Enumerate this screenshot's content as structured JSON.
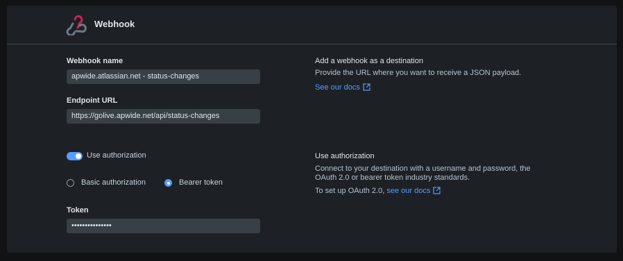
{
  "header": {
    "title": "Webhook"
  },
  "form": {
    "webhook_name_label": "Webhook name",
    "webhook_name_value": "apwide.atlassian.net - status-changes",
    "endpoint_url_label": "Endpoint URL",
    "endpoint_url_value": "https://golive.apwide.net/api/status-changes",
    "use_authorization_label": "Use authorization",
    "use_authorization_enabled": true,
    "auth_options": [
      {
        "label": "Basic authorization",
        "selected": false
      },
      {
        "label": "Bearer token",
        "selected": true
      }
    ],
    "token_label": "Token",
    "token_value": "•••••••••••••••"
  },
  "info": {
    "destination_title": "Add a webhook as a destination",
    "destination_text": "Provide the URL where you want to receive a JSON payload.",
    "destination_link": "See our docs",
    "auth_title": "Use authorization",
    "auth_text_line1": "Connect to your destination with a username and password, the",
    "auth_text_line2": "OAuth 2.0 or bearer token industry standards.",
    "oauth_prefix": "To set up OAuth 2.0,",
    "oauth_link": "see our docs"
  },
  "colors": {
    "accent": "#579dff",
    "logo_pink": "#c8255b",
    "panel": "#1d2125"
  },
  "icons": {
    "logo": "webhook-logo-icon",
    "external": "external-link-icon"
  }
}
